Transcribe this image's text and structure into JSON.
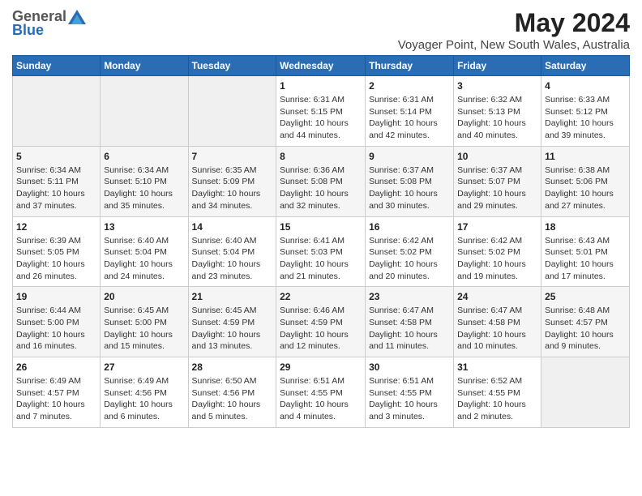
{
  "logo": {
    "general": "General",
    "blue": "Blue"
  },
  "header": {
    "title": "May 2024",
    "subtitle": "Voyager Point, New South Wales, Australia"
  },
  "days_of_week": [
    "Sunday",
    "Monday",
    "Tuesday",
    "Wednesday",
    "Thursday",
    "Friday",
    "Saturday"
  ],
  "weeks": [
    [
      {
        "day": "",
        "info": ""
      },
      {
        "day": "",
        "info": ""
      },
      {
        "day": "",
        "info": ""
      },
      {
        "day": "1",
        "info": "Sunrise: 6:31 AM\nSunset: 5:15 PM\nDaylight: 10 hours\nand 44 minutes."
      },
      {
        "day": "2",
        "info": "Sunrise: 6:31 AM\nSunset: 5:14 PM\nDaylight: 10 hours\nand 42 minutes."
      },
      {
        "day": "3",
        "info": "Sunrise: 6:32 AM\nSunset: 5:13 PM\nDaylight: 10 hours\nand 40 minutes."
      },
      {
        "day": "4",
        "info": "Sunrise: 6:33 AM\nSunset: 5:12 PM\nDaylight: 10 hours\nand 39 minutes."
      }
    ],
    [
      {
        "day": "5",
        "info": "Sunrise: 6:34 AM\nSunset: 5:11 PM\nDaylight: 10 hours\nand 37 minutes."
      },
      {
        "day": "6",
        "info": "Sunrise: 6:34 AM\nSunset: 5:10 PM\nDaylight: 10 hours\nand 35 minutes."
      },
      {
        "day": "7",
        "info": "Sunrise: 6:35 AM\nSunset: 5:09 PM\nDaylight: 10 hours\nand 34 minutes."
      },
      {
        "day": "8",
        "info": "Sunrise: 6:36 AM\nSunset: 5:08 PM\nDaylight: 10 hours\nand 32 minutes."
      },
      {
        "day": "9",
        "info": "Sunrise: 6:37 AM\nSunset: 5:08 PM\nDaylight: 10 hours\nand 30 minutes."
      },
      {
        "day": "10",
        "info": "Sunrise: 6:37 AM\nSunset: 5:07 PM\nDaylight: 10 hours\nand 29 minutes."
      },
      {
        "day": "11",
        "info": "Sunrise: 6:38 AM\nSunset: 5:06 PM\nDaylight: 10 hours\nand 27 minutes."
      }
    ],
    [
      {
        "day": "12",
        "info": "Sunrise: 6:39 AM\nSunset: 5:05 PM\nDaylight: 10 hours\nand 26 minutes."
      },
      {
        "day": "13",
        "info": "Sunrise: 6:40 AM\nSunset: 5:04 PM\nDaylight: 10 hours\nand 24 minutes."
      },
      {
        "day": "14",
        "info": "Sunrise: 6:40 AM\nSunset: 5:04 PM\nDaylight: 10 hours\nand 23 minutes."
      },
      {
        "day": "15",
        "info": "Sunrise: 6:41 AM\nSunset: 5:03 PM\nDaylight: 10 hours\nand 21 minutes."
      },
      {
        "day": "16",
        "info": "Sunrise: 6:42 AM\nSunset: 5:02 PM\nDaylight: 10 hours\nand 20 minutes."
      },
      {
        "day": "17",
        "info": "Sunrise: 6:42 AM\nSunset: 5:02 PM\nDaylight: 10 hours\nand 19 minutes."
      },
      {
        "day": "18",
        "info": "Sunrise: 6:43 AM\nSunset: 5:01 PM\nDaylight: 10 hours\nand 17 minutes."
      }
    ],
    [
      {
        "day": "19",
        "info": "Sunrise: 6:44 AM\nSunset: 5:00 PM\nDaylight: 10 hours\nand 16 minutes."
      },
      {
        "day": "20",
        "info": "Sunrise: 6:45 AM\nSunset: 5:00 PM\nDaylight: 10 hours\nand 15 minutes."
      },
      {
        "day": "21",
        "info": "Sunrise: 6:45 AM\nSunset: 4:59 PM\nDaylight: 10 hours\nand 13 minutes."
      },
      {
        "day": "22",
        "info": "Sunrise: 6:46 AM\nSunset: 4:59 PM\nDaylight: 10 hours\nand 12 minutes."
      },
      {
        "day": "23",
        "info": "Sunrise: 6:47 AM\nSunset: 4:58 PM\nDaylight: 10 hours\nand 11 minutes."
      },
      {
        "day": "24",
        "info": "Sunrise: 6:47 AM\nSunset: 4:58 PM\nDaylight: 10 hours\nand 10 minutes."
      },
      {
        "day": "25",
        "info": "Sunrise: 6:48 AM\nSunset: 4:57 PM\nDaylight: 10 hours\nand 9 minutes."
      }
    ],
    [
      {
        "day": "26",
        "info": "Sunrise: 6:49 AM\nSunset: 4:57 PM\nDaylight: 10 hours\nand 7 minutes."
      },
      {
        "day": "27",
        "info": "Sunrise: 6:49 AM\nSunset: 4:56 PM\nDaylight: 10 hours\nand 6 minutes."
      },
      {
        "day": "28",
        "info": "Sunrise: 6:50 AM\nSunset: 4:56 PM\nDaylight: 10 hours\nand 5 minutes."
      },
      {
        "day": "29",
        "info": "Sunrise: 6:51 AM\nSunset: 4:55 PM\nDaylight: 10 hours\nand 4 minutes."
      },
      {
        "day": "30",
        "info": "Sunrise: 6:51 AM\nSunset: 4:55 PM\nDaylight: 10 hours\nand 3 minutes."
      },
      {
        "day": "31",
        "info": "Sunrise: 6:52 AM\nSunset: 4:55 PM\nDaylight: 10 hours\nand 2 minutes."
      },
      {
        "day": "",
        "info": ""
      }
    ]
  ]
}
